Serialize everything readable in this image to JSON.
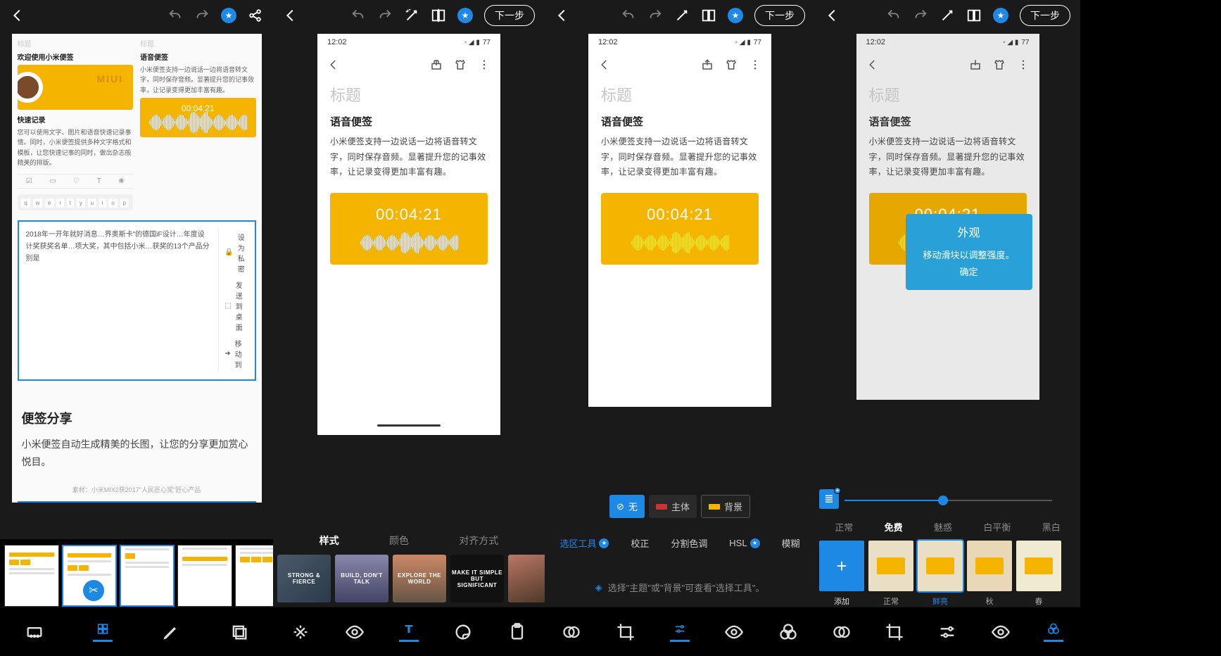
{
  "statusbar_time": "12:02",
  "statusbar_battery": "77",
  "next_step_label": "下一步",
  "phone_note": {
    "title_placeholder": "标题",
    "heading": "语音便签",
    "body": "小米便签支持一边说话一边将语音转文字，同时保存音频。显著提升您的记事效率，让记录变得更加丰富有趣。",
    "audio_time": "00:04:21"
  },
  "panel1": {
    "col_a_label": "标题",
    "col_a_heading": "欢迎使用小米便签",
    "miui": "MIUI",
    "quick_title": "快速记录",
    "quick_body": "您可以使用文字、图片和语音快速记录事情。同时，小米便签提供多种文字格式和模板，让您快速记事的同时，做出杂志般精美的排版。",
    "col_b_label": "标题",
    "col_b_heading": "语音便签",
    "col_b_body": "小米便签支持一边说话一边将语音转文字，同时保存音频。显著提升您的记事效率，让记录变得更加丰富有趣。",
    "audio_time": "00:04:21",
    "crop_text": "2018年一开年就好消息…界奥斯卡\"的德国iF设计…年度设计奖获奖名单…项大奖，其中包括小米…获奖的13个产品分别是",
    "menu_private": "设为私密",
    "menu_desktop": "发送到桌面",
    "menu_move": "移动到",
    "share_h": "便签分享",
    "share_p": "小米便签自动生成精美的长图，让您的分享更加赏心悦目。",
    "caption": "素材：小米MIX2获2017\"人民匠心奖\"匠心产品"
  },
  "panel2": {
    "tabs": [
      "样式",
      "颜色",
      "对齐方式"
    ],
    "style_cards": [
      "STRONG & FIERCE",
      "BUILD, DON'T TALK",
      "EXPLORE THE WORLD",
      "MAKE IT SIMPLE BUT SIGNIFICANT",
      ""
    ]
  },
  "panel3": {
    "region_none": "无",
    "region_subject": "主体",
    "region_bg": "背景",
    "tools": [
      "选区工具",
      "校正",
      "分割色调",
      "HSL",
      "模糊"
    ],
    "tip_text": "选择\"主题\"或\"背景\"可查看\"选择工具\"。"
  },
  "panel4": {
    "tooltip_title": "外观",
    "tooltip_body": "移动滑块以调整强度。",
    "tooltip_confirm": "确定",
    "categories": [
      "正常",
      "免费",
      "魅惑",
      "白平衡",
      "黑白"
    ],
    "presets": [
      {
        "label": "添加",
        "kind": "add"
      },
      {
        "label": "正常"
      },
      {
        "label": "鲜亮",
        "selected": true
      },
      {
        "label": "秋"
      },
      {
        "label": "春"
      }
    ]
  },
  "bottom_tools": {
    "p1": [
      "aspect-icon",
      "grid-icon",
      "pencil-icon",
      "layers-icon"
    ],
    "p2": [
      "heal-icon",
      "eye-icon",
      "text-icon",
      "paint-icon",
      "clipboard-icon"
    ],
    "p3": [
      "overlap-icon",
      "crop-icon",
      "sliders-icon",
      "eye-icon",
      "mix-icon"
    ],
    "p4": [
      "overlap-icon",
      "crop-icon",
      "sliders-icon",
      "eye-icon",
      "mix-icon"
    ]
  }
}
